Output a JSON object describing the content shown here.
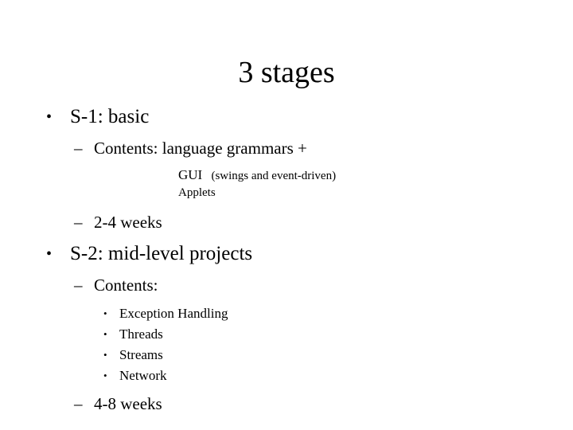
{
  "slide": {
    "title": "3 stages",
    "background_color": "#ffffff",
    "text_color": "#000000",
    "bullet_glyph_level1": "•",
    "bullet_glyph_level2": "–",
    "bullet_glyph_level3": "•",
    "outline": [
      {
        "level": 1,
        "marker": "•",
        "text": "S-1:  basic"
      },
      {
        "level": 2,
        "marker": "–",
        "text": "Contents:  language grammars +"
      },
      {
        "level": 3,
        "marker": "",
        "lead": "GUI",
        "text": "(swings and event-driven)"
      },
      {
        "level": 3,
        "marker": "",
        "lead": "",
        "text": "Applets"
      },
      {
        "level": 2,
        "marker": "–",
        "text": "2-4  weeks"
      },
      {
        "level": 1,
        "marker": "•",
        "text": "S-2:  mid-level projects"
      },
      {
        "level": 2,
        "marker": "–",
        "text": "Contents:"
      },
      {
        "level": 3,
        "marker": "•",
        "text": "Exception Handling"
      },
      {
        "level": 3,
        "marker": "•",
        "text": "Threads"
      },
      {
        "level": 3,
        "marker": "•",
        "text": "Streams"
      },
      {
        "level": 3,
        "marker": "•",
        "text": "Network"
      },
      {
        "level": 2,
        "marker": "–",
        "text": "4-8 weeks"
      }
    ]
  }
}
